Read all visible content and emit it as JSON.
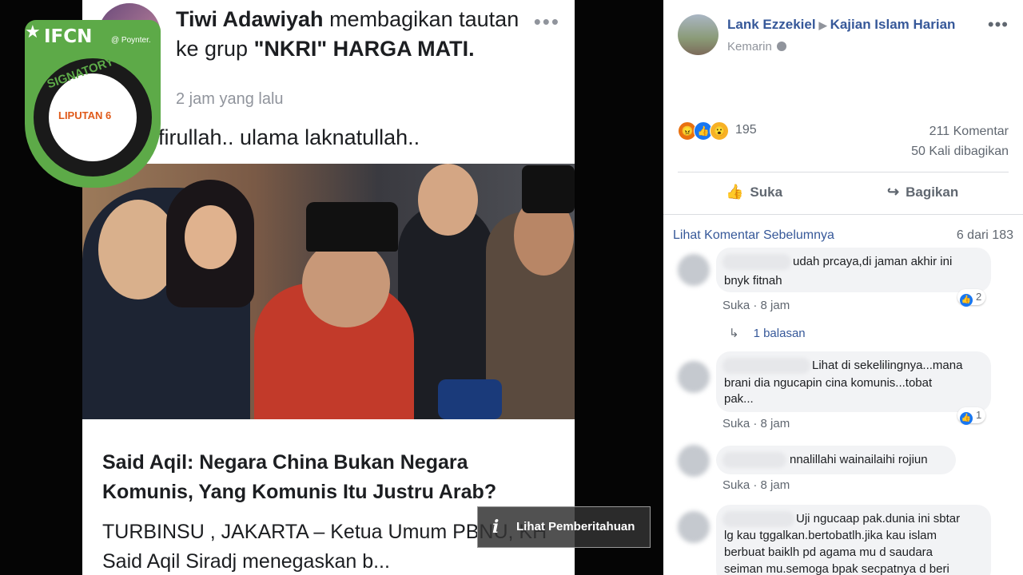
{
  "post": {
    "author": "Tiwi Adawiyah",
    "action_text": "membagikan tautan ke grup",
    "group": "\"NKRI\" HARGA MATI.",
    "time": "2 jam yang lalu",
    "text": "firullah.. ulama laknatullah..",
    "article": {
      "title": "Said Aqil: Negara China Bukan Negara Komunis, Yang Komunis Itu Justru Arab?",
      "desc": "TURBINSU , JAKARTA – Ketua Umum PBNU, KH Said Aqil Siradj menegaskan b..."
    },
    "notification": "Lihat Pemberitahuan"
  },
  "badge": {
    "top": "IFCN",
    "poynter": "@ Poynter.",
    "signatory": "SIGNATORY",
    "logo": "LIPUTAN 6"
  },
  "side": {
    "author": "Lank Ezzekiel",
    "target": "Kajian Islam Harian",
    "time": "Kemarin",
    "reaction_count": "195",
    "comments": "211 Komentar",
    "shares": "50 Kali dibagikan",
    "like_label": "Suka",
    "share_label": "Bagikan",
    "prev_comments": "Lihat Komentar Sebelumnya",
    "page_count": "6 dari 183",
    "comment_list": [
      {
        "line1": "udah prcaya,di jaman akhir ini",
        "line2": "bnyk fitnah",
        "line3": "",
        "line4": "",
        "like_label": "Suka",
        "time": "8 jam",
        "likes": "2"
      },
      {
        "line1": "Lihat di sekelilingnya...mana",
        "line2": "brani dia ngucapin cina komunis...tobat",
        "line3": "pak...",
        "line4": "",
        "like_label": "Suka",
        "time": "8 jam",
        "likes": "1"
      },
      {
        "line1": "nnalillahi wainailaihi rojiun",
        "line2": "",
        "line3": "",
        "line4": "",
        "like_label": "Suka",
        "time": "8 jam",
        "likes": ""
      },
      {
        "line1": "Uji ngucaap pak.dunia ini sbtar",
        "line2": "lg kau tggalkan.bertobatlh.jika kau islam",
        "line3": "berbuat baiklh pd agama mu d saudara",
        "line4": "seiman mu.semoga bpak secpatnya d beri",
        "like_label": "",
        "time": "",
        "likes": ""
      }
    ],
    "reply_text": "1 balasan"
  },
  "icons": {
    "more": "more-dots-icon",
    "info": "info-icon",
    "like": "thumbs-up-icon",
    "share": "share-arrow-icon",
    "globe": "globe-icon",
    "reply": "reply-arrow-icon"
  }
}
